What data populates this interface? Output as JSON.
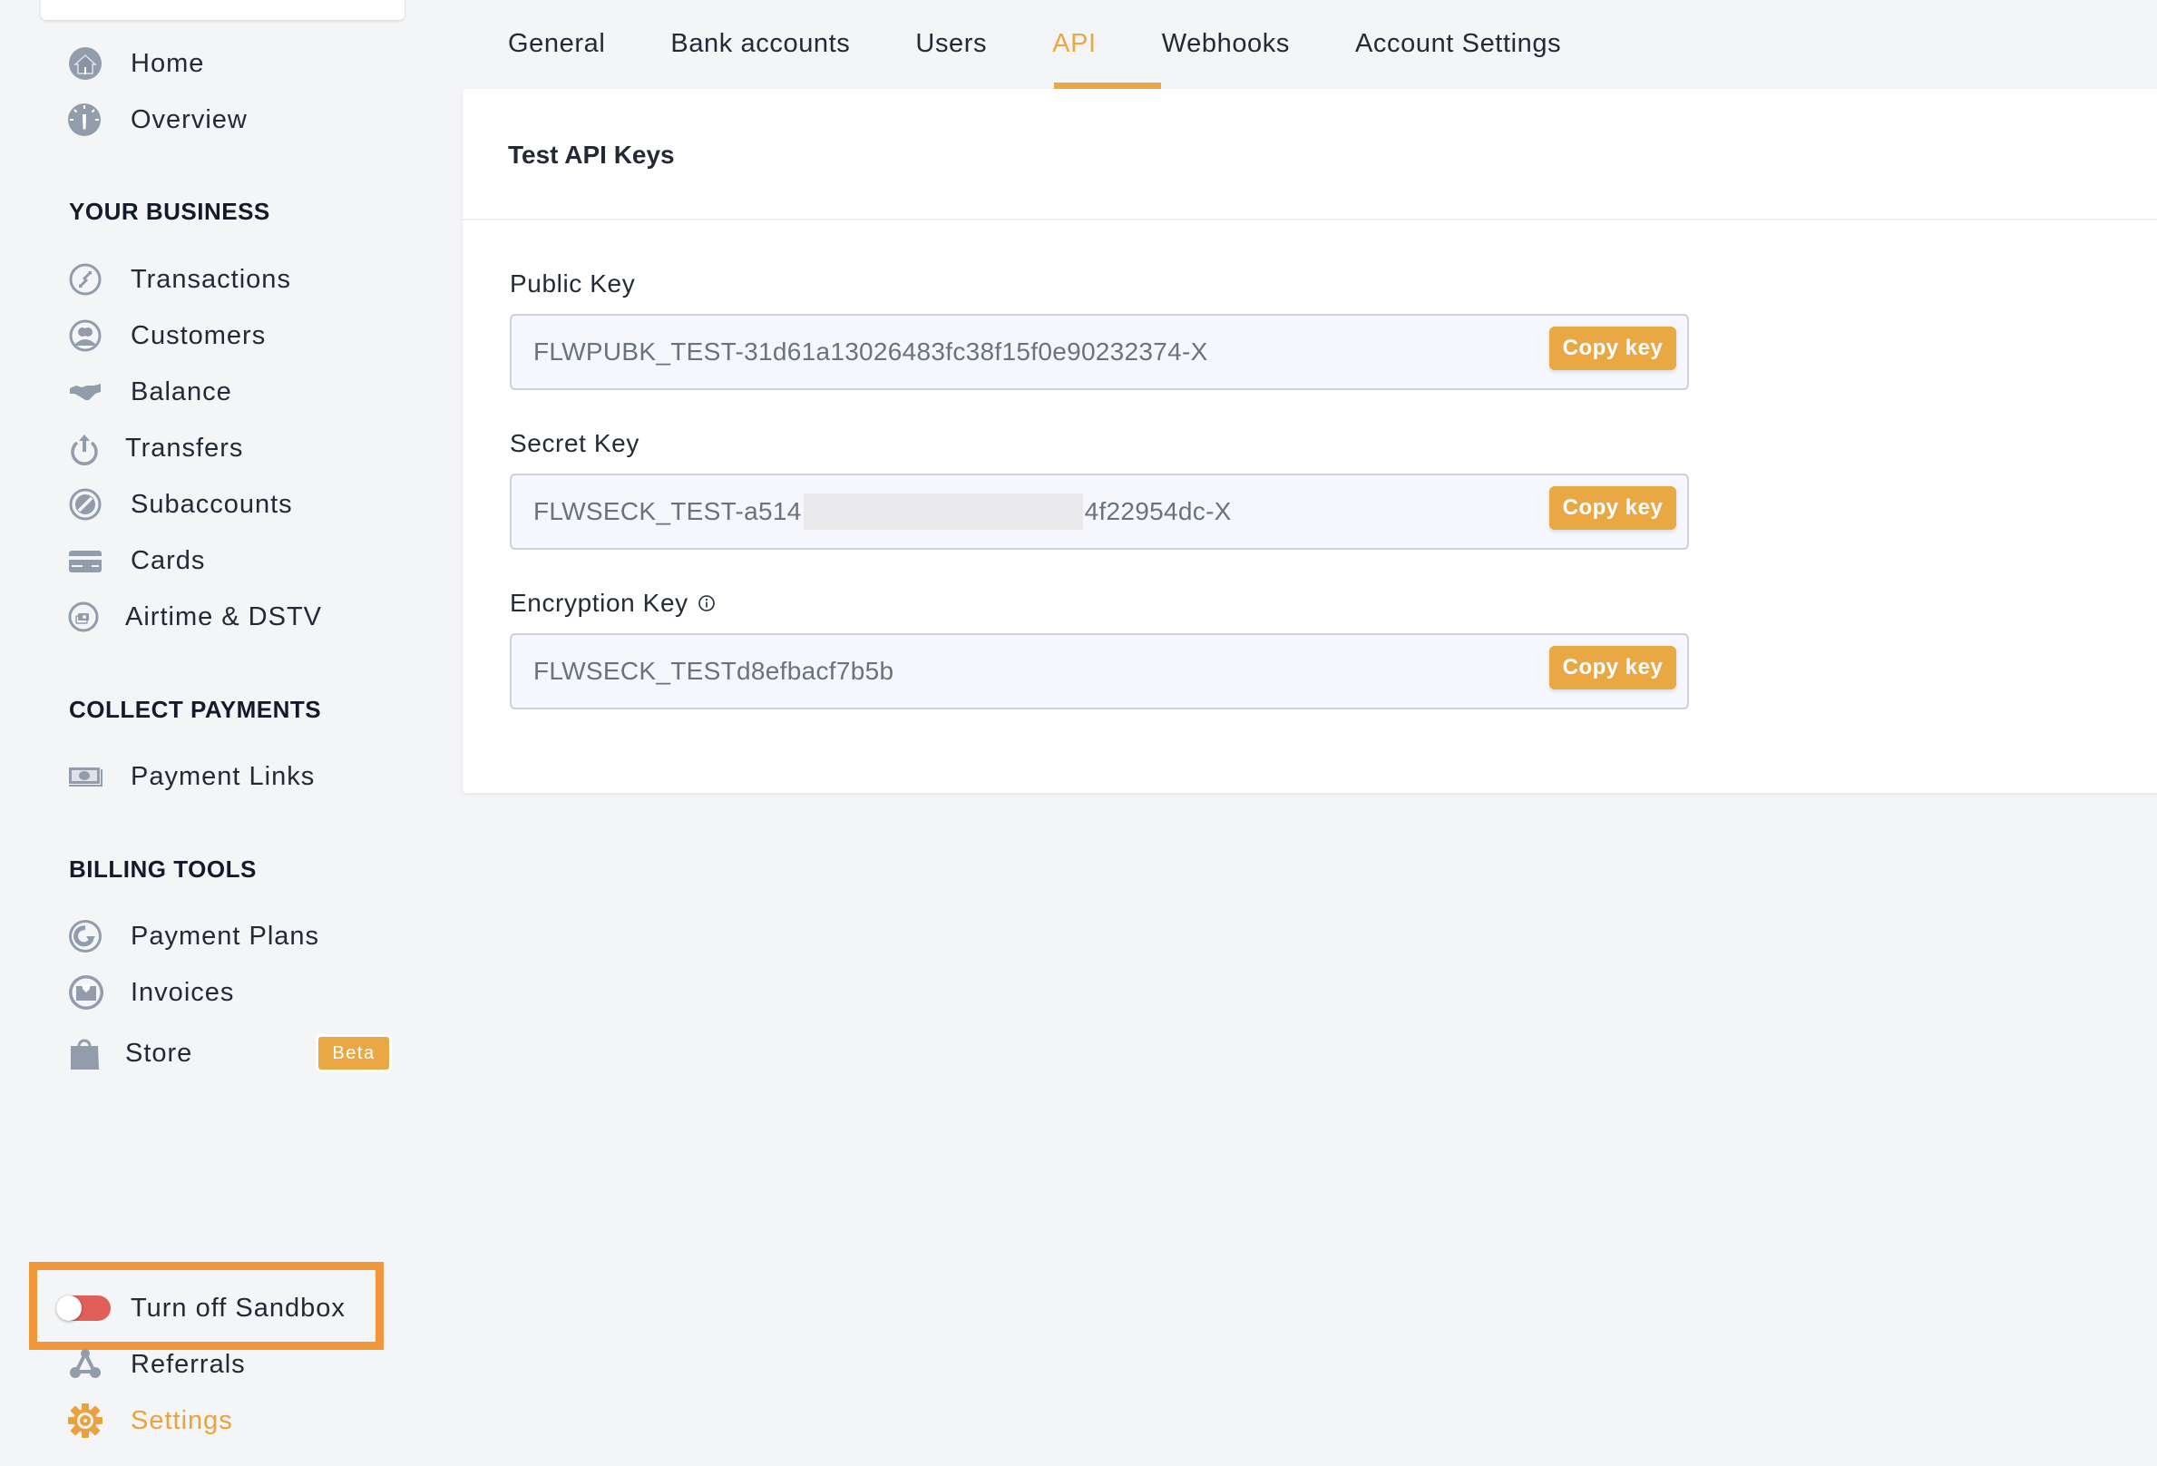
{
  "sidebar": {
    "top": [
      {
        "label": "Home",
        "icon": "home-icon"
      },
      {
        "label": "Overview",
        "icon": "dashboard-gauge-icon"
      }
    ],
    "sections": [
      {
        "title": "YOUR BUSINESS",
        "items": [
          {
            "label": "Transactions",
            "icon": "transactions-arrows-icon"
          },
          {
            "label": "Customers",
            "icon": "customers-icon"
          },
          {
            "label": "Balance",
            "icon": "handshake-icon"
          },
          {
            "label": "Transfers",
            "icon": "transfer-upload-icon"
          },
          {
            "label": "Subaccounts",
            "icon": "subaccounts-icon"
          },
          {
            "label": "Cards",
            "icon": "credit-card-icon"
          },
          {
            "label": "Airtime & DSTV",
            "icon": "airtime-icon"
          }
        ]
      },
      {
        "title": "COLLECT PAYMENTS",
        "items": [
          {
            "label": "Payment Links",
            "icon": "cash-icon"
          }
        ]
      },
      {
        "title": "BILLING TOOLS",
        "items": [
          {
            "label": "Payment Plans",
            "icon": "recurring-icon"
          },
          {
            "label": "Invoices",
            "icon": "invoice-icon"
          },
          {
            "label": "Store",
            "icon": "shopping-bag-icon",
            "badge": "Beta"
          }
        ]
      }
    ],
    "bottom": {
      "sandbox_toggle": {
        "label": "Turn off Sandbox",
        "state": "on"
      },
      "referrals": "Referrals",
      "settings": "Settings"
    }
  },
  "tabs": {
    "items": [
      "General",
      "Bank accounts",
      "Users",
      "API",
      "Webhooks",
      "Account Settings"
    ],
    "active": "API"
  },
  "card": {
    "title": "Test API Keys",
    "fields": [
      {
        "label": "Public Key",
        "value": "FLWPUBK_TEST-31d61a13026483fc38f15f0e90232374-X",
        "button": "Copy key"
      },
      {
        "label": "Secret Key",
        "value_prefix": "FLWSECK_TEST-a514",
        "value_suffix": "4f22954dc-X",
        "redacted": true,
        "button": "Copy key"
      },
      {
        "label": "Encryption Key",
        "value": "FLWSECK_TESTd8efbacf7b5b",
        "button": "Copy key",
        "has_info_icon": true
      }
    ]
  },
  "colors": {
    "accent": "#eaa845",
    "highlight_box": "#f0973a",
    "toggle": "#e05f5a",
    "icon_gray": "#939cab",
    "background": "#f4f5f7"
  }
}
